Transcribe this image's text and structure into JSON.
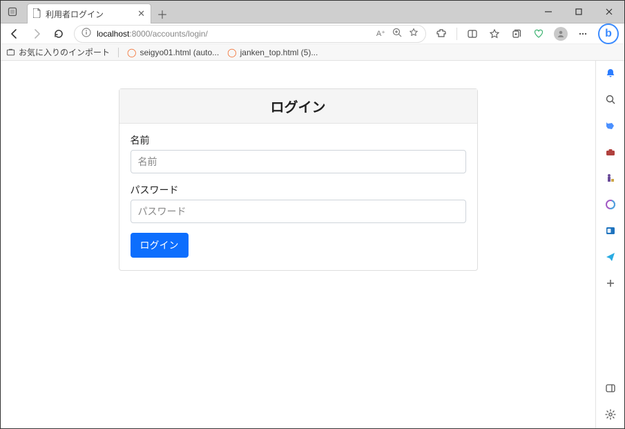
{
  "window": {
    "tab_title": "利用者ログイン",
    "url_host": "localhost",
    "url_rest": ":8000/accounts/login/"
  },
  "toolbar": {
    "read_aloud": "A⁺",
    "bing_letter": "b"
  },
  "bookmarks": {
    "import_label": "お気に入りのインポート",
    "items": [
      {
        "label": "seigyo01.html (auto..."
      },
      {
        "label": "janken_top.html (5)..."
      }
    ]
  },
  "login": {
    "header": "ログイン",
    "name_label": "名前",
    "name_placeholder": "名前",
    "password_label": "パスワード",
    "password_placeholder": "パスワード",
    "submit_label": "ログイン"
  },
  "colors": {
    "accent": "#0d6efd",
    "bing_blue": "#3a8aff",
    "swirl_orange": "#f26522"
  }
}
